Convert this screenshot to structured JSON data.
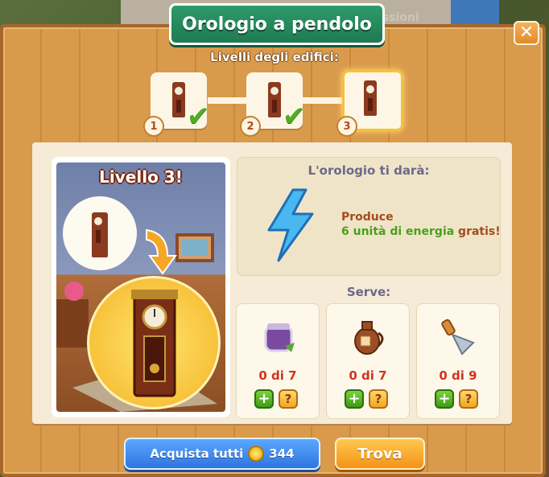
{
  "title": "Orologio a pendolo",
  "background_label": "issioni",
  "close_icon": "close-icon",
  "levels": {
    "heading": "Livelli degli edifici:",
    "items": [
      {
        "number": "1",
        "completed": true
      },
      {
        "number": "2",
        "completed": true
      },
      {
        "number": "3",
        "completed": false,
        "active": true
      }
    ]
  },
  "preview": {
    "level_title": "Livello 3!"
  },
  "reward": {
    "heading": "L'orologio ti darà:",
    "icon": "lightning-icon",
    "line1": "Produce",
    "line2_highlight": "6 unità di energia",
    "line2_rest": " gratis!"
  },
  "requirements": {
    "heading": "Serve:",
    "items": [
      {
        "icon": "jar-icon",
        "count": "0 di 7"
      },
      {
        "icon": "jug-icon",
        "count": "0 di 7"
      },
      {
        "icon": "trowel-icon",
        "count": "0 di 9"
      }
    ]
  },
  "buttons": {
    "buy_all_label": "Acquista tutti",
    "buy_all_price": "344",
    "find_label": "Trova"
  },
  "colors": {
    "accent_green": "#1f7a52",
    "buy_blue": "#2f74e0",
    "find_orange": "#f29218",
    "count_red": "#d2331d"
  }
}
